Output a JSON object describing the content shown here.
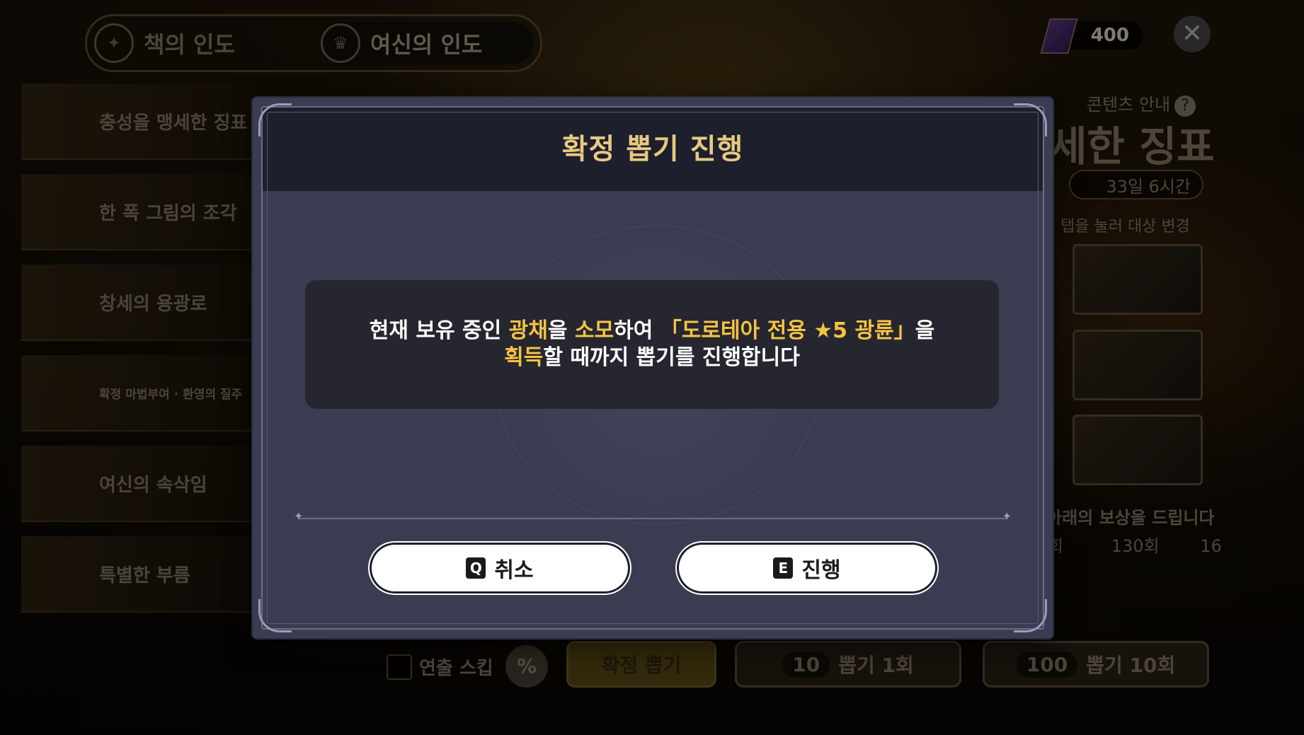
{
  "top_tabs": [
    {
      "label": "책의 인도",
      "icon": "compass-emblem-icon"
    },
    {
      "label": "여신의 인도",
      "icon": "goddess-emblem-icon",
      "active": true
    }
  ],
  "currency": {
    "value": "400",
    "icon": "book-gem-icon"
  },
  "side_list": [
    {
      "label": "충성을 맹세한 징표"
    },
    {
      "label": "한 폭 그림의 조각"
    },
    {
      "label": "창세의 용광로"
    },
    {
      "label": "확정 마법부여 · 환영의 질주"
    },
    {
      "label": "여신의 속삭임"
    },
    {
      "label": "특별한 부름"
    }
  ],
  "right_panel": {
    "guide_label": "콘텐츠 안내",
    "title_fragment": "세한 징표",
    "timer": "33일 6시간",
    "tap_hint": "탭을 눌러 대상 변경",
    "reward_text": "아래의 보상을 드립니다",
    "reward_cols": [
      "회",
      "130회",
      "16"
    ]
  },
  "bottom": {
    "skip_label": "연출 스킵",
    "guaranteed_label": "확정 뽑기",
    "draw1": {
      "count": "10",
      "label": "뽑기 1회"
    },
    "draw10": {
      "count": "100",
      "label": "뽑기 10회"
    }
  },
  "modal": {
    "title": "확정 뽑기 진행",
    "message": {
      "p1": "현재 보유 중인 ",
      "h1": "광채",
      "p2": "을 ",
      "h2": "소모",
      "p3": "하여 ",
      "h3": "「도로테아 전용 ★5 광륜」",
      "p4": "을",
      "h4": "획득",
      "p5": "할 때까지 뽑기를 진행합니다"
    },
    "cancel": {
      "key": "Q",
      "label": "취소"
    },
    "confirm": {
      "key": "E",
      "label": "진행"
    }
  },
  "colors": {
    "modal_bg": "#3a3d52",
    "title_gold": "#e8c982",
    "highlight": "#f6c343"
  }
}
